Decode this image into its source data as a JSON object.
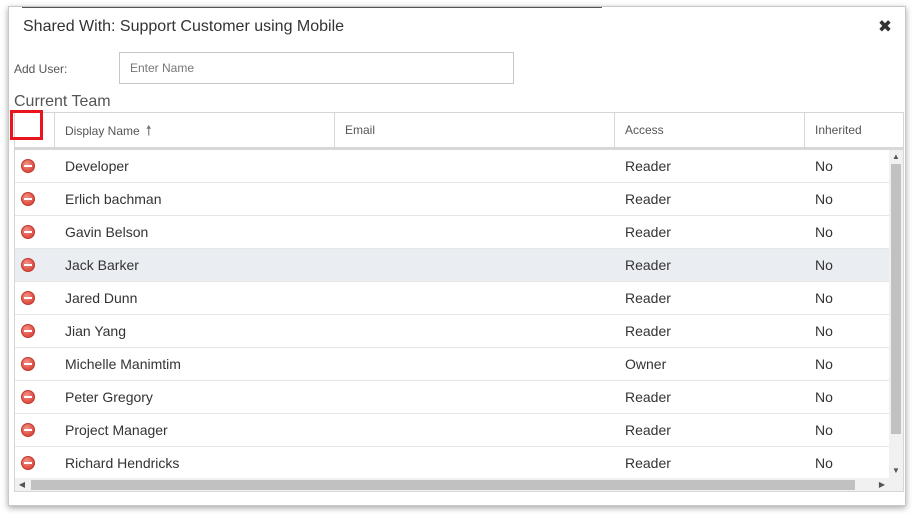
{
  "dialog": {
    "title": "Shared With: Support Customer using Mobile",
    "close_icon": "close-icon"
  },
  "add_user": {
    "label": "Add User:",
    "placeholder": "Enter Name",
    "value": ""
  },
  "section_title": "Current Team",
  "grid": {
    "columns": [
      {
        "key": "remove",
        "label": ""
      },
      {
        "key": "display_name",
        "label": "Display Name",
        "sort": "ascending",
        "sort_icon": "sort-ascending-arrow-icon"
      },
      {
        "key": "email",
        "label": "Email"
      },
      {
        "key": "access",
        "label": "Access"
      },
      {
        "key": "inherited",
        "label": "Inherited"
      }
    ],
    "remove_icon": "remove-circle-icon",
    "selected_row_index": 3,
    "rows": [
      {
        "display_name": "Developer",
        "email": "",
        "access": "Reader",
        "inherited": "No"
      },
      {
        "display_name": "Erlich bachman",
        "email": "",
        "access": "Reader",
        "inherited": "No"
      },
      {
        "display_name": "Gavin Belson",
        "email": "",
        "access": "Reader",
        "inherited": "No"
      },
      {
        "display_name": "Jack Barker",
        "email": "",
        "access": "Reader",
        "inherited": "No"
      },
      {
        "display_name": "Jared Dunn",
        "email": "",
        "access": "Reader",
        "inherited": "No"
      },
      {
        "display_name": "Jian Yang",
        "email": "",
        "access": "Reader",
        "inherited": "No"
      },
      {
        "display_name": "Michelle Manimtim",
        "email": "",
        "access": "Owner",
        "inherited": "No"
      },
      {
        "display_name": "Peter Gregory",
        "email": "",
        "access": "Reader",
        "inherited": "No"
      },
      {
        "display_name": "Project Manager",
        "email": "",
        "access": "Reader",
        "inherited": "No"
      },
      {
        "display_name": "Richard Hendricks",
        "email": "",
        "access": "Reader",
        "inherited": "No"
      }
    ]
  },
  "colors": {
    "highlight_box": "#e8151e",
    "remove_icon": "#e25a4f",
    "selected_row": "#eaeef2"
  }
}
